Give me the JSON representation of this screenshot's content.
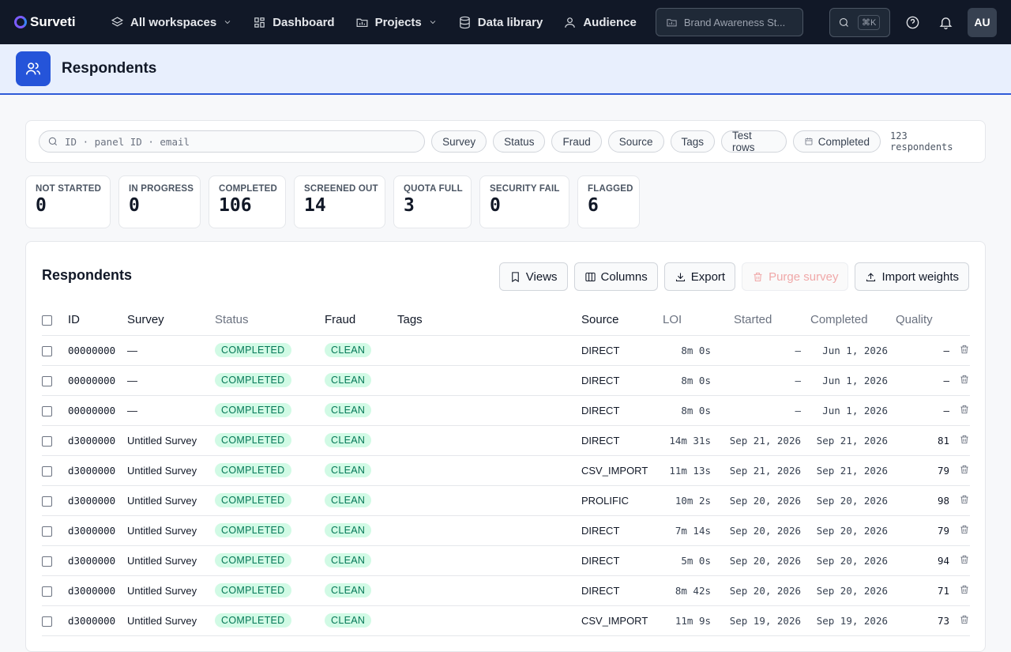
{
  "nav": {
    "brand": "Surveti",
    "workspace": "All workspaces",
    "items": [
      "Dashboard",
      "Projects",
      "Data library",
      "Audience"
    ],
    "survey_selector": "Brand Awareness St...",
    "search_shortcut": "⌘K",
    "avatar": "AU"
  },
  "header": {
    "title": "Respondents"
  },
  "filters": {
    "search_placeholder": "ID · panel ID · email",
    "chips": [
      "Survey",
      "Status",
      "Fraud",
      "Source",
      "Tags",
      "Test rows"
    ],
    "completed_chip": "Completed",
    "count": "123 respondents"
  },
  "stats": [
    {
      "label": "NOT STARTED",
      "value": "0"
    },
    {
      "label": "IN PROGRESS",
      "value": "0"
    },
    {
      "label": "COMPLETED",
      "value": "106"
    },
    {
      "label": "SCREENED OUT",
      "value": "14"
    },
    {
      "label": "QUOTA FULL",
      "value": "3"
    },
    {
      "label": "SECURITY FAIL",
      "value": "0"
    },
    {
      "label": "FLAGGED",
      "value": "6"
    }
  ],
  "table": {
    "title": "Respondents",
    "actions": {
      "views": "Views",
      "columns": "Columns",
      "export": "Export",
      "purge": "Purge survey",
      "import": "Import weights"
    },
    "headers": {
      "id": "ID",
      "survey": "Survey",
      "status": "Status",
      "fraud": "Fraud",
      "tags": "Tags",
      "source": "Source",
      "loi": "LOI",
      "started": "Started",
      "completed": "Completed",
      "quality": "Quality"
    },
    "rows": [
      {
        "id": "00000000",
        "survey": "—",
        "status": "COMPLETED",
        "fraud": "CLEAN",
        "tags": "",
        "source": "DIRECT",
        "loi": "8m 0s",
        "started": "–",
        "completed": "Jun 1, 2026",
        "quality": "–"
      },
      {
        "id": "00000000",
        "survey": "—",
        "status": "COMPLETED",
        "fraud": "CLEAN",
        "tags": "",
        "source": "DIRECT",
        "loi": "8m 0s",
        "started": "–",
        "completed": "Jun 1, 2026",
        "quality": "–"
      },
      {
        "id": "00000000",
        "survey": "—",
        "status": "COMPLETED",
        "fraud": "CLEAN",
        "tags": "",
        "source": "DIRECT",
        "loi": "8m 0s",
        "started": "–",
        "completed": "Jun 1, 2026",
        "quality": "–"
      },
      {
        "id": "d3000000",
        "survey": "Untitled Survey",
        "status": "COMPLETED",
        "fraud": "CLEAN",
        "tags": "",
        "source": "DIRECT",
        "loi": "14m 31s",
        "started": "Sep 21, 2026",
        "completed": "Sep 21, 2026",
        "quality": "81"
      },
      {
        "id": "d3000000",
        "survey": "Untitled Survey",
        "status": "COMPLETED",
        "fraud": "CLEAN",
        "tags": "",
        "source": "CSV_IMPORT",
        "loi": "11m 13s",
        "started": "Sep 21, 2026",
        "completed": "Sep 21, 2026",
        "quality": "79"
      },
      {
        "id": "d3000000",
        "survey": "Untitled Survey",
        "status": "COMPLETED",
        "fraud": "CLEAN",
        "tags": "",
        "source": "PROLIFIC",
        "loi": "10m 2s",
        "started": "Sep 20, 2026",
        "completed": "Sep 20, 2026",
        "quality": "98"
      },
      {
        "id": "d3000000",
        "survey": "Untitled Survey",
        "status": "COMPLETED",
        "fraud": "CLEAN",
        "tags": "",
        "source": "DIRECT",
        "loi": "7m 14s",
        "started": "Sep 20, 2026",
        "completed": "Sep 20, 2026",
        "quality": "79"
      },
      {
        "id": "d3000000",
        "survey": "Untitled Survey",
        "status": "COMPLETED",
        "fraud": "CLEAN",
        "tags": "",
        "source": "DIRECT",
        "loi": "5m 0s",
        "started": "Sep 20, 2026",
        "completed": "Sep 20, 2026",
        "quality": "94"
      },
      {
        "id": "d3000000",
        "survey": "Untitled Survey",
        "status": "COMPLETED",
        "fraud": "CLEAN",
        "tags": "",
        "source": "DIRECT",
        "loi": "8m 42s",
        "started": "Sep 20, 2026",
        "completed": "Sep 20, 2026",
        "quality": "71"
      },
      {
        "id": "d3000000",
        "survey": "Untitled Survey",
        "status": "COMPLETED",
        "fraud": "CLEAN",
        "tags": "",
        "source": "CSV_IMPORT",
        "loi": "11m 9s",
        "started": "Sep 19, 2026",
        "completed": "Sep 19, 2026",
        "quality": "73"
      }
    ]
  },
  "colors": {
    "nav_bg": "#111827",
    "accent": "#2554d9",
    "header_bg": "#e8effd",
    "badge_green_bg": "#d1fae5",
    "badge_green_text": "#047857",
    "purge_disabled": "#f0a8a8"
  }
}
